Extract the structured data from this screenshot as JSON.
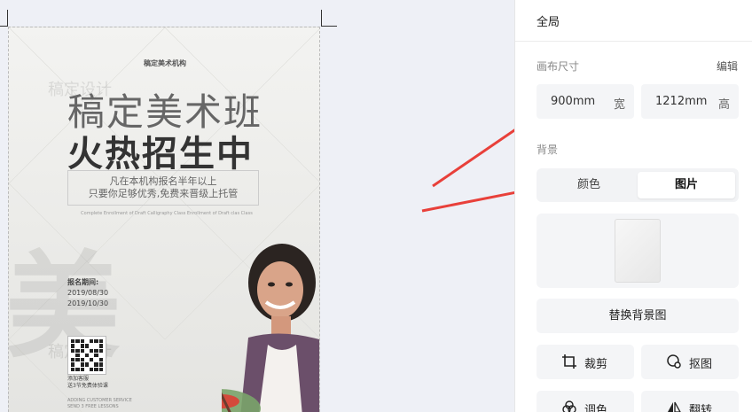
{
  "panel": {
    "title": "全局",
    "canvas_size_label": "画布尺寸",
    "edit_label": "编辑",
    "width_value": "900mm",
    "width_unit": "宽",
    "height_value": "1212mm",
    "height_unit": "高",
    "background_label": "背景",
    "tabs": [
      {
        "label": "颜色",
        "active": false
      },
      {
        "label": "图片",
        "active": true
      }
    ],
    "replace_bg_label": "替换背景图",
    "tools": [
      {
        "label": "裁剪",
        "icon": "crop-icon"
      },
      {
        "label": "抠图",
        "icon": "cutout-icon"
      },
      {
        "label": "调色",
        "icon": "color-adjust-icon"
      },
      {
        "label": "翻转",
        "icon": "flip-icon"
      }
    ]
  },
  "poster": {
    "org": "稿定美术机构",
    "title_line1": "稿定美术班",
    "title_line2": "火热招生中",
    "box_line1": "凡在本机构报名半年以上",
    "box_line2": "只要你足够优秀,免费来晋级上托管",
    "english": "Complete Enrollment of Draft Calligraphy Class Enrollment of Draft clas Class",
    "period_label": "报名期间:",
    "date_start": "2019/08/30",
    "date_end": "2019/10/30",
    "qr_text1": "添加客服",
    "qr_text2": "送3节免费体验课",
    "small_en1": "ADDING CUSTOMER SERVICE",
    "small_en2": "SEND 3 FREE LESSONS",
    "watermark": "稿定设计",
    "big_watermark": "美"
  },
  "colors": {
    "accent_arrow": "#e8403a",
    "panel_bg": "#ffffff",
    "canvas_bg": "#eef0f6"
  }
}
